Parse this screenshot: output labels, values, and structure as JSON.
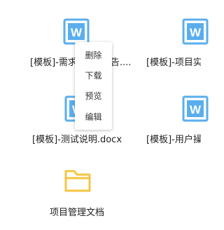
{
  "files": [
    {
      "name": "[模板]-需求规格说明书.docx",
      "display": "[模板]-需求",
      "display_tail": "告....",
      "type": "word-icon",
      "accent": "#5aaeee"
    },
    {
      "name": "[模板]-项目实施",
      "display": "[模板]-项目实",
      "type": "word-icon",
      "accent": "#5aaeee"
    },
    {
      "name": "[模板]-测试说明.docx",
      "display": "[模板]-测试说明.docx",
      "type": "word-icon",
      "accent": "#5aaeee"
    },
    {
      "name": "[模板]-用户操作",
      "display": "[模板]-用户操",
      "type": "word-icon",
      "accent": "#5aaeee"
    },
    {
      "name": "项目管理文档",
      "display": "项目管理文档",
      "type": "folder-icon",
      "accent": "#f5c542"
    }
  ],
  "context_menu": {
    "items": [
      {
        "label": "删除"
      },
      {
        "label": "下载"
      },
      {
        "label": "预览"
      },
      {
        "label": "编辑"
      }
    ]
  }
}
